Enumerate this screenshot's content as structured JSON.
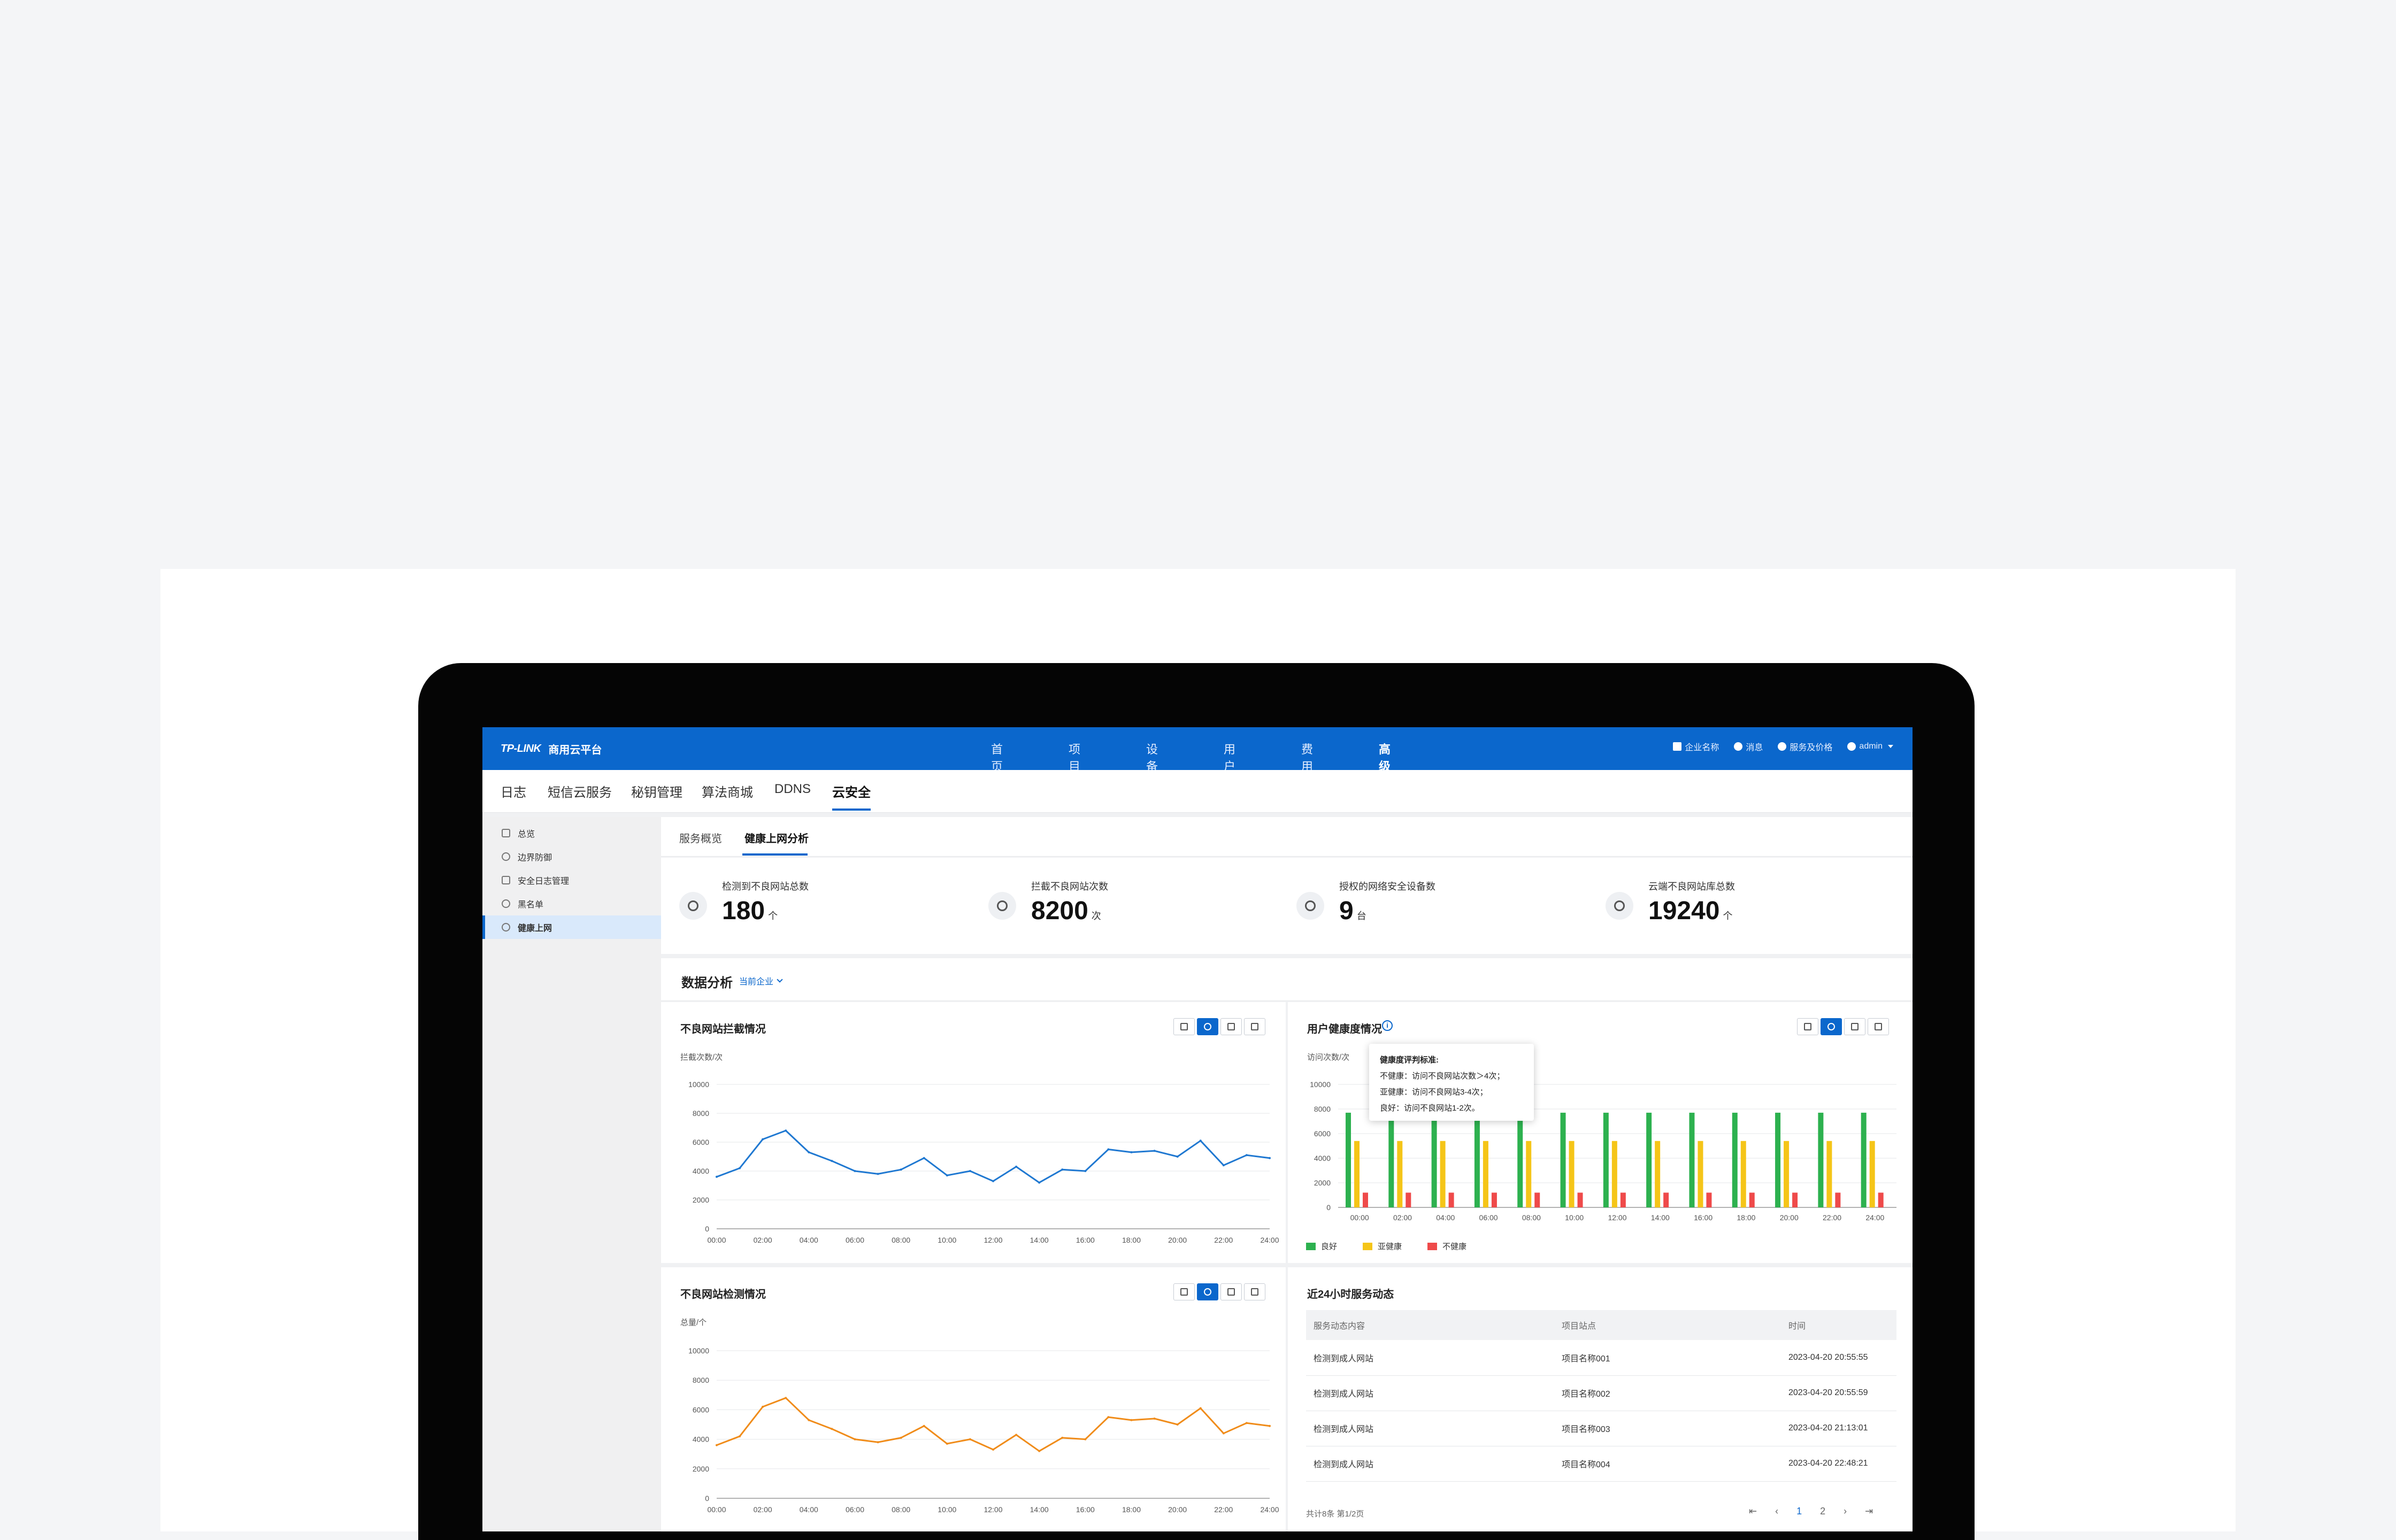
{
  "app": {
    "brand": "TP-LINK",
    "product_name": "商用云平台"
  },
  "topnav": [
    {
      "label": "首页"
    },
    {
      "label": "项目"
    },
    {
      "label": "设备"
    },
    {
      "label": "用户"
    },
    {
      "label": "费用"
    },
    {
      "label": "高级",
      "active": true
    }
  ],
  "topright": {
    "company": "企业名称",
    "messages": "消息",
    "pricing": "服务及价格",
    "user": "admin"
  },
  "subnav": [
    {
      "label": "日志"
    },
    {
      "label": "短信云服务"
    },
    {
      "label": "秘钥管理"
    },
    {
      "label": "算法商城"
    },
    {
      "label": "DDNS"
    },
    {
      "label": "云安全",
      "active": true
    }
  ],
  "sidebar": [
    {
      "label": "总览",
      "icon": "grid-icon"
    },
    {
      "label": "边界防御",
      "icon": "shield-icon"
    },
    {
      "label": "安全日志管理",
      "icon": "document-icon"
    },
    {
      "label": "黑名单",
      "icon": "user-block-icon"
    },
    {
      "label": "健康上网",
      "icon": "globe-icon",
      "active": true
    }
  ],
  "tabs": [
    {
      "label": "服务概览"
    },
    {
      "label": "健康上网分析",
      "active": true
    }
  ],
  "stats": [
    {
      "label": "检测到不良网站总数",
      "value": "180",
      "unit": "个",
      "icon": "globe-icon"
    },
    {
      "label": "拦截不良网站次数",
      "value": "8200",
      "unit": "次",
      "icon": "shield-check-icon"
    },
    {
      "label": "授权的网络安全设备数",
      "value": "9",
      "unit": "台",
      "icon": "device-icon"
    },
    {
      "label": "云端不良网站库总数",
      "value": "19240",
      "unit": "个",
      "icon": "cloud-icon"
    }
  ],
  "analysis": {
    "title": "数据分析",
    "filter": "当前企业"
  },
  "panels": {
    "block_chart": {
      "title": "不良网站拦截情况",
      "unit": "拦截次数/次"
    },
    "health_chart": {
      "title": "用户健康度情况",
      "unit": "访问次数/次"
    },
    "detect_chart": {
      "title": "不良网站检测情况",
      "unit": "总量/个"
    },
    "service_log": {
      "title": "近24小时服务动态"
    }
  },
  "tooltip": {
    "title": "健康度评判标准:",
    "lines": [
      "不健康：访问不良网站次数＞4次；",
      "亚健康：访问不良网站3-4次；",
      "良好：访问不良网站1-2次。"
    ]
  },
  "colors": {
    "primary": "#0b67cc",
    "blue_line": "#1f78d1",
    "orange_line": "#f08c1a",
    "good": "#2db14f",
    "sub": "#f5c518",
    "bad": "#ef4a4a"
  },
  "chart_data": [
    {
      "type": "line",
      "title": "不良网站拦截情况",
      "ylabel": "拦截次数/次",
      "ylim": [
        0,
        10000
      ],
      "yticks": [
        "0",
        "2000",
        "4000",
        "6000",
        "8000",
        "10000"
      ],
      "xticks": [
        "00:00",
        "02:00",
        "04:00",
        "06:00",
        "08:00",
        "10:00",
        "12:00",
        "14:00",
        "16:00",
        "18:00",
        "20:00",
        "22:00",
        "24:00"
      ],
      "x": [
        0,
        1,
        2,
        3,
        4,
        5,
        6,
        7,
        8,
        9,
        10,
        11,
        12,
        13,
        14,
        15,
        16,
        17,
        18,
        19,
        20,
        21,
        22,
        23,
        24
      ],
      "series": [
        {
          "values": [
            3600,
            4200,
            6200,
            6800,
            5300,
            4700,
            4000,
            3800,
            4100,
            4900,
            3700,
            4000,
            3300,
            4300,
            3200,
            4100,
            4000,
            5500,
            5300,
            5400,
            5000,
            6100,
            4400,
            5100,
            4900
          ]
        }
      ],
      "grid": true
    },
    {
      "type": "bar",
      "title": "用户健康度情况",
      "ylabel": "访问次数/次",
      "ylim": [
        0,
        10000
      ],
      "yticks": [
        "0",
        "2000",
        "4000",
        "6000",
        "8000",
        "10000"
      ],
      "categories": [
        "00:00",
        "02:00",
        "04:00",
        "06:00",
        "08:00",
        "10:00",
        "12:00",
        "14:00",
        "16:00",
        "18:00",
        "20:00",
        "22:00",
        "24:00"
      ],
      "series": [
        {
          "name": "良好",
          "values": [
            7700,
            7700,
            7700,
            7700,
            7700,
            7700,
            7700,
            7700,
            7700,
            7700,
            7700,
            7700,
            7700
          ]
        },
        {
          "name": "亚健康",
          "values": [
            5400,
            5400,
            5400,
            5400,
            5400,
            5400,
            5400,
            5400,
            5400,
            5400,
            5400,
            5400,
            5400
          ]
        },
        {
          "name": "不健康",
          "values": [
            1200,
            1200,
            1200,
            1200,
            1200,
            1200,
            1200,
            1200,
            1200,
            1200,
            1200,
            1200,
            1200
          ]
        }
      ],
      "legend": "bottom-left",
      "grid": true
    },
    {
      "type": "line",
      "title": "不良网站检测情况",
      "ylabel": "总量/个",
      "ylim": [
        0,
        10000
      ],
      "yticks": [
        "0",
        "2000",
        "4000",
        "6000",
        "8000",
        "10000"
      ],
      "xticks": [
        "00:00",
        "02:00",
        "04:00",
        "06:00",
        "08:00",
        "10:00",
        "12:00",
        "14:00",
        "16:00",
        "18:00",
        "20:00",
        "22:00",
        "24:00"
      ],
      "x": [
        0,
        1,
        2,
        3,
        4,
        5,
        6,
        7,
        8,
        9,
        10,
        11,
        12,
        13,
        14,
        15,
        16,
        17,
        18,
        19,
        20,
        21,
        22,
        23,
        24
      ],
      "series": [
        {
          "values": [
            3600,
            4200,
            6200,
            6800,
            5300,
            4700,
            4000,
            3800,
            4100,
            4900,
            3700,
            4000,
            3300,
            4300,
            3200,
            4100,
            4000,
            5500,
            5300,
            5400,
            5000,
            6100,
            4400,
            5100,
            4900
          ]
        }
      ],
      "grid": true
    }
  ],
  "service_table": {
    "headers": [
      "服务动态内容",
      "项目站点",
      "时间"
    ],
    "rows": [
      [
        "检测到成人网站",
        "项目名称001",
        "2023-04-20 20:55:55"
      ],
      [
        "检测到成人网站",
        "项目名称002",
        "2023-04-20 20:55:59"
      ],
      [
        "检测到成人网站",
        "项目名称003",
        "2023-04-20 21:13:01"
      ],
      [
        "检测到成人网站",
        "项目名称004",
        "2023-04-20 22:48:21"
      ]
    ],
    "summary": "共计8条  第1/2页",
    "pages": [
      "1",
      "2"
    ],
    "current_page": "1"
  }
}
